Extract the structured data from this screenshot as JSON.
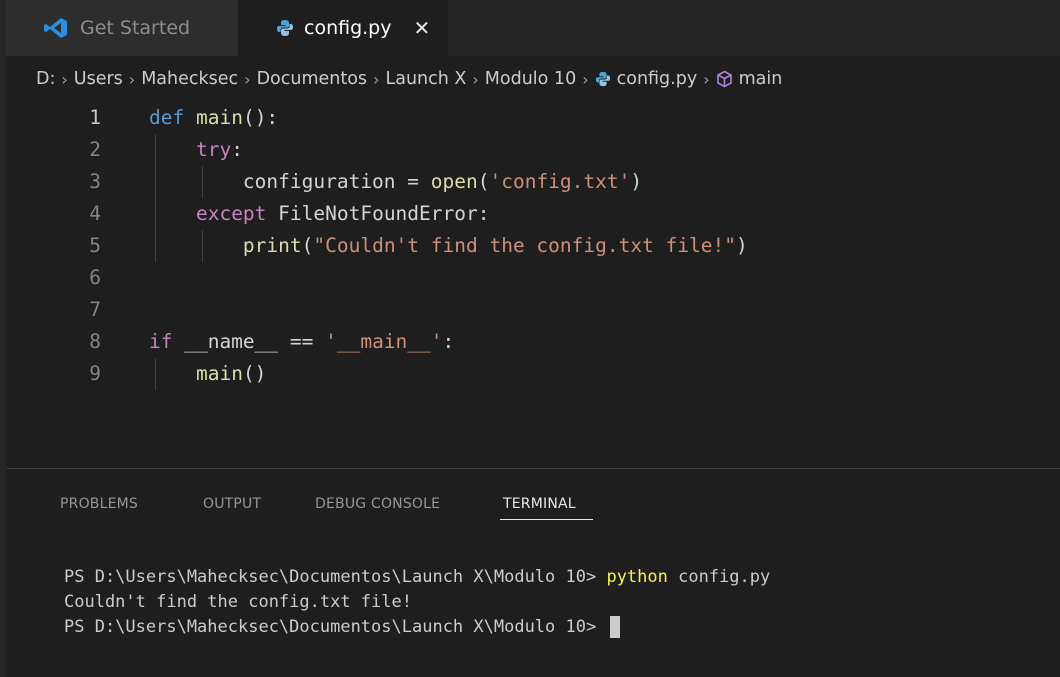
{
  "tabs": [
    {
      "label": "Get Started",
      "icon": "vscode-icon",
      "active": false
    },
    {
      "label": "config.py",
      "icon": "python-icon",
      "active": true,
      "close": "✕"
    }
  ],
  "breadcrumb": {
    "drive": "D:",
    "items": [
      "Users",
      "Mahecksec",
      "Documentos",
      "Launch X",
      "Modulo 10"
    ],
    "file": "config.py",
    "symbol": "main",
    "separator": "›"
  },
  "editor": {
    "line_numbers": [
      "1",
      "2",
      "3",
      "4",
      "5",
      "6",
      "7",
      "8",
      "9"
    ],
    "lines": [
      {
        "tokens": [
          [
            "def",
            "kw-blue"
          ],
          [
            " ",
            ""
          ],
          [
            "main",
            "fn"
          ],
          [
            "():",
            ""
          ]
        ]
      },
      {
        "tokens": [
          [
            "    ",
            ""
          ],
          [
            "try",
            "kw-purple"
          ],
          [
            ":",
            ""
          ]
        ]
      },
      {
        "tokens": [
          [
            "        configuration = ",
            "var-plain"
          ],
          [
            "open",
            "fn"
          ],
          [
            "(",
            ""
          ],
          [
            "'config.txt'",
            "str"
          ],
          [
            ")",
            ""
          ]
        ]
      },
      {
        "tokens": [
          [
            "    ",
            ""
          ],
          [
            "except",
            "kw-purple"
          ],
          [
            " FileNotFoundError:",
            ""
          ]
        ]
      },
      {
        "tokens": [
          [
            "        ",
            ""
          ],
          [
            "print",
            "fn"
          ],
          [
            "(",
            ""
          ],
          [
            "\"Couldn't find the config.txt file!\"",
            "str"
          ],
          [
            ")",
            ""
          ]
        ]
      },
      {
        "tokens": []
      },
      {
        "tokens": []
      },
      {
        "tokens": [
          [
            "if",
            "kw-purple"
          ],
          [
            " __name__ == ",
            ""
          ],
          [
            "'__main__'",
            "str"
          ],
          [
            ":",
            ""
          ]
        ]
      },
      {
        "tokens": [
          [
            "    ",
            ""
          ],
          [
            "main",
            "fn"
          ],
          [
            "()",
            ""
          ]
        ]
      }
    ]
  },
  "panel": {
    "tabs": [
      "PROBLEMS",
      "OUTPUT",
      "DEBUG CONSOLE",
      "TERMINAL"
    ],
    "active_tab": "TERMINAL"
  },
  "terminal": {
    "prompt": "PS D:\\Users\\Mahecksec\\Documentos\\Launch X\\Modulo 10> ",
    "command": "python",
    "args": " config.py",
    "output": "Couldn't find the config.txt file!",
    "prompt2": "PS D:\\Users\\Mahecksec\\Documentos\\Launch X\\Modulo 10> "
  }
}
